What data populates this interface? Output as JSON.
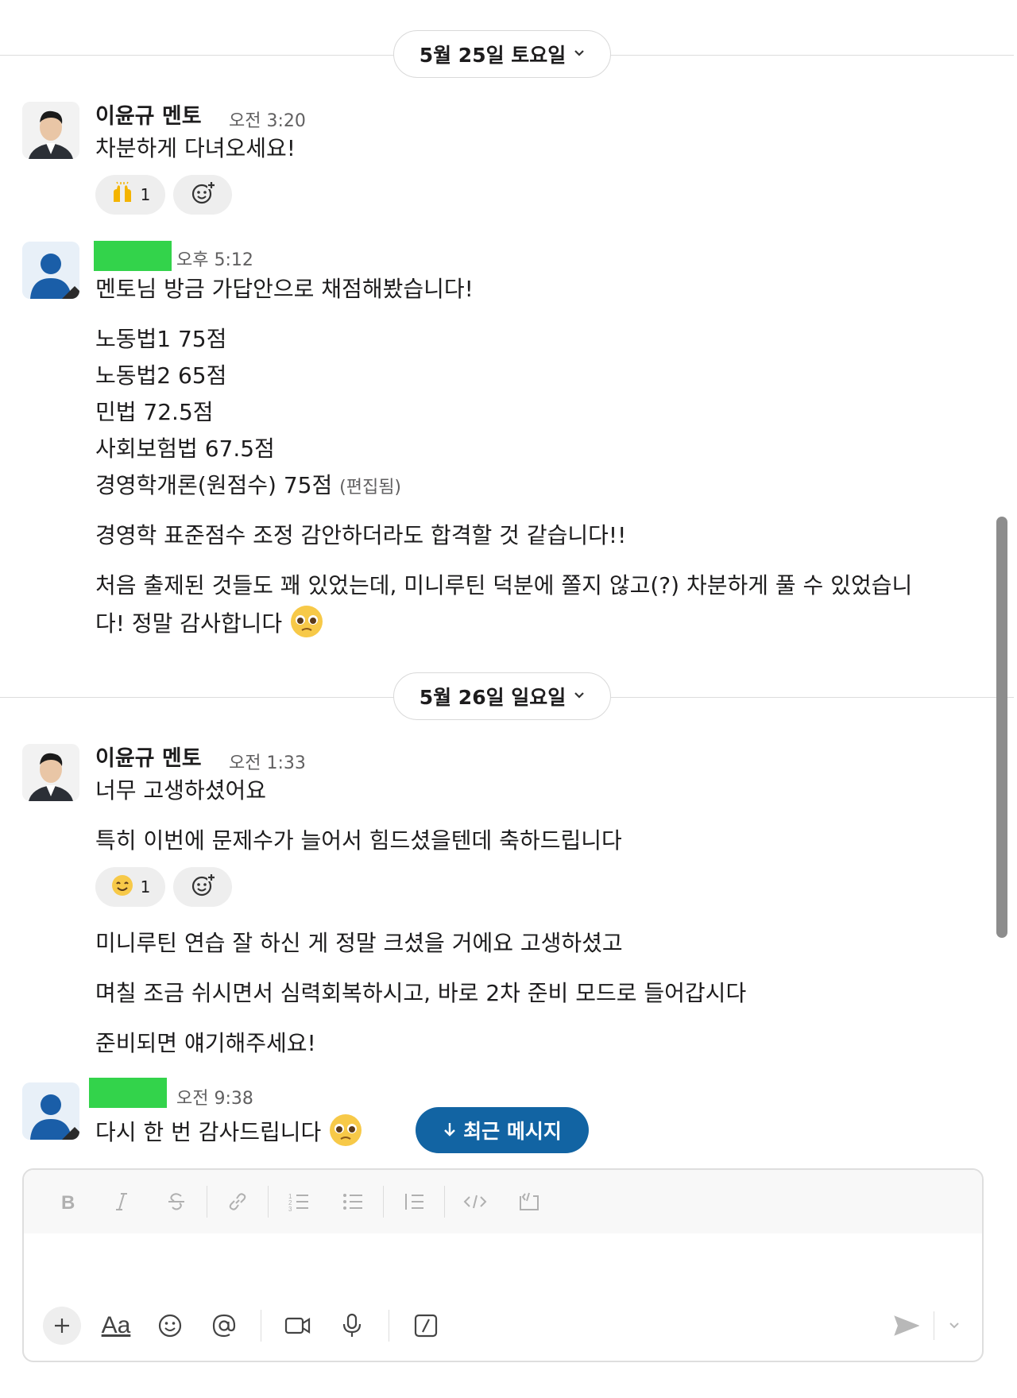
{
  "dividers": [
    {
      "label": "5월 25일 토요일"
    },
    {
      "label": "5월 26일 일요일"
    }
  ],
  "messages": {
    "m1": {
      "sender": "이윤규 멘토",
      "time": "오전 3:20",
      "lines": [
        "차분하게 다녀오세요!"
      ]
    },
    "m1_reactions": [
      {
        "emoji": "raised-hands",
        "count": "1"
      }
    ],
    "m2": {
      "sender": "",
      "time": "오후 5:12",
      "lines": [
        "멘토님 방금 가답안으로 채점해봤습니다!",
        "노동법1 75점",
        "노동법2 65점",
        "민법 72.5점",
        "사회보험법 67.5점",
        "경영학개론(원점수) 75점",
        "경영학 표준점수 조정 감안하더라도 합격할 것 같습니다!!",
        "처음 출제된 것들도 꽤 있었는데, 미니루틴 덕분에 쫄지 않고(?) 차분하게 풀 수 있었습니",
        "다! 정말 감사합니다"
      ],
      "edited": "(편집됨)"
    },
    "m3": {
      "sender": "이윤규 멘토",
      "time": "오전 1:33",
      "lines": [
        "너무 고생하셨어요",
        "특히 이번에 문제수가 늘어서 힘드셨을텐데 축하드립니다",
        "미니루틴 연습 잘 하신 게 정말 크셨을 거에요 고생하셨고",
        "며칠 조금 쉬시면서 심력회복하시고, 바로 2차 준비 모드로 들어갑시다",
        "준비되면 얘기해주세요!"
      ]
    },
    "m3_reactions": [
      {
        "emoji": "smiling-face",
        "count": "1"
      }
    ],
    "m4": {
      "sender": "",
      "time": "오전 9:38",
      "lines": [
        "다시 한 번 감사드립니다"
      ]
    }
  },
  "new_messages_button": {
    "label": "최근 메시지"
  },
  "composer": {
    "toolbar_icons": [
      "bold-icon",
      "italic-icon",
      "strikethrough-icon",
      "link-icon",
      "ordered-list-icon",
      "bullet-list-icon",
      "blockquote-icon",
      "code-icon",
      "code-block-icon"
    ],
    "bottom_icons": [
      "plus-icon",
      "format-icon",
      "emoji-icon",
      "mention-icon",
      "video-icon",
      "microphone-icon",
      "slash-command-icon"
    ],
    "format_label": "Aa"
  },
  "colors": {
    "accent": "#1264a3",
    "redaction": "#33d34b"
  }
}
